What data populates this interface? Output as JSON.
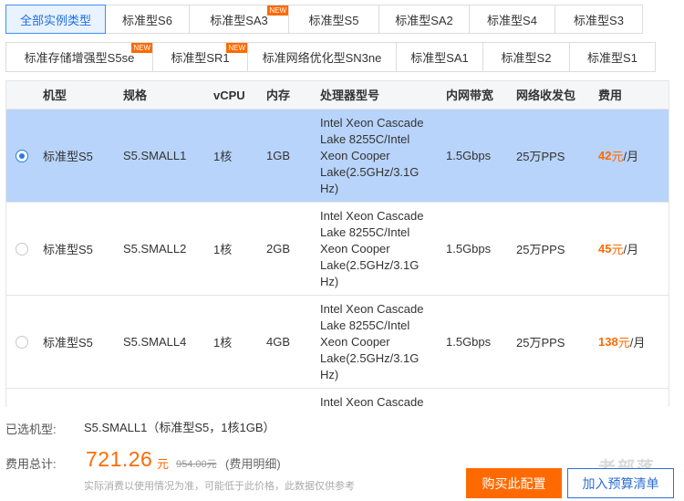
{
  "tabs_row1": [
    {
      "label": "全部实例类型",
      "active": true,
      "badge": ""
    },
    {
      "label": "标准型S6",
      "active": false,
      "badge": ""
    },
    {
      "label": "标准型SA3",
      "active": false,
      "badge": "NEW"
    },
    {
      "label": "标准型S5",
      "active": false,
      "badge": ""
    },
    {
      "label": "标准型SA2",
      "active": false,
      "badge": ""
    },
    {
      "label": "标准型S4",
      "active": false,
      "badge": ""
    },
    {
      "label": "标准型S3",
      "active": false,
      "badge": ""
    }
  ],
  "tabs_row2": [
    {
      "label": "标准存储增强型S5se",
      "active": false,
      "badge": "NEW"
    },
    {
      "label": "标准型SR1",
      "active": false,
      "badge": "NEW"
    },
    {
      "label": "标准网络优化型SN3ne",
      "active": false,
      "badge": ""
    },
    {
      "label": "标准型SA1",
      "active": false,
      "badge": ""
    },
    {
      "label": "标准型S2",
      "active": false,
      "badge": ""
    },
    {
      "label": "标准型S1",
      "active": false,
      "badge": ""
    }
  ],
  "table": {
    "headers": {
      "model": "机型",
      "spec": "规格",
      "vcpu": "vCPU",
      "memory": "内存",
      "cpu_model": "处理器型号",
      "bandwidth": "内网带宽",
      "pps": "网络收发包",
      "price": "费用"
    },
    "rows": [
      {
        "selected": true,
        "model": "标准型S5",
        "spec": "S5.SMALL1",
        "vcpu": "1核",
        "memory": "1GB",
        "cpu_lines": [
          "Intel Xeon Cascade",
          "Lake 8255C/Intel",
          "Xeon Cooper",
          "Lake(2.5GHz/3.1G",
          "Hz)"
        ],
        "bandwidth": "1.5Gbps",
        "pps": "25万PPS",
        "price_num": "42",
        "price_unit": "元",
        "price_per": "/月"
      },
      {
        "selected": false,
        "model": "标准型S5",
        "spec": "S5.SMALL2",
        "vcpu": "1核",
        "memory": "2GB",
        "cpu_lines": [
          "Intel Xeon Cascade",
          "Lake 8255C/Intel",
          "Xeon Cooper",
          "Lake(2.5GHz/3.1G",
          "Hz)"
        ],
        "bandwidth": "1.5Gbps",
        "pps": "25万PPS",
        "price_num": "45",
        "price_unit": "元",
        "price_per": "/月"
      },
      {
        "selected": false,
        "model": "标准型S5",
        "spec": "S5.SMALL4",
        "vcpu": "1核",
        "memory": "4GB",
        "cpu_lines": [
          "Intel Xeon Cascade",
          "Lake 8255C/Intel",
          "Xeon Cooper",
          "Lake(2.5GHz/3.1G",
          "Hz)"
        ],
        "bandwidth": "1.5Gbps",
        "pps": "25万PPS",
        "price_num": "138",
        "price_unit": "元",
        "price_per": "/月"
      },
      {
        "selected": false,
        "model": "",
        "spec": "",
        "vcpu": "",
        "memory": "",
        "cpu_lines": [
          "Intel Xeon Cascade"
        ],
        "bandwidth": "",
        "pps": "",
        "price_num": "",
        "price_unit": "",
        "price_per": ""
      }
    ]
  },
  "summary": {
    "selected_label": "已选机型:",
    "selected_value": "S5.SMALL1（标准型S5，1核1GB）",
    "total_label": "费用总计:",
    "total_value": "721.26",
    "total_unit": "元",
    "original_price": "954.00元",
    "detail_link": "(费用明细)",
    "note": "实际消费以使用情况为准，可能低于此价格，此数据仅供参考"
  },
  "buttons": {
    "buy": "购买此配置",
    "budget": "加入预算清单"
  },
  "watermark": "老部落",
  "colors": {
    "accent": "#ff6a00",
    "primary": "#2c6fd6",
    "selected_row": "#b8d4fa"
  }
}
